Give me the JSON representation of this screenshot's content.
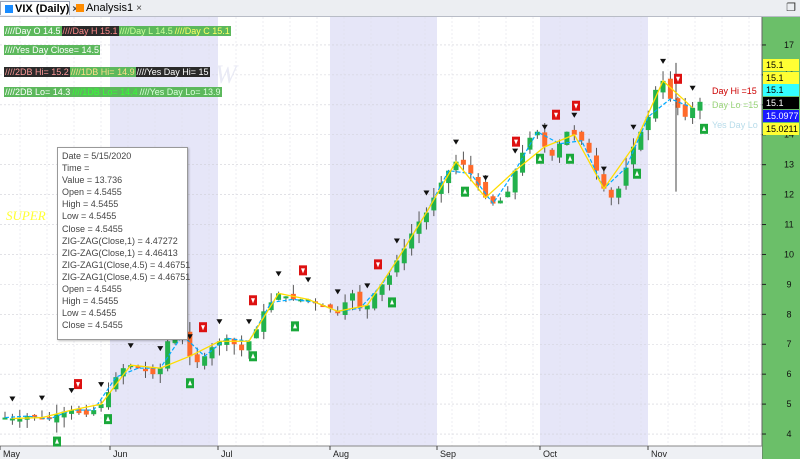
{
  "tabs": [
    {
      "label": "VIX (Daily)",
      "active": true
    },
    {
      "label": "Analysis1",
      "active": false
    }
  ],
  "header": {
    "row1": [
      "////Day O 14.5",
      "////Day H 15.1",
      "////Day L 14.5",
      "////Day C 15.1"
    ],
    "row2": "////Yes Day Close= 14.5",
    "row3": [
      "////2DB Hi= 15.2",
      "////1DB Hi= 14.9",
      "////Yes Day Hi= 15"
    ],
    "row4": [
      "////2DB Lo= 14.3",
      "////1DB Lo= 14.4",
      "////Yes Day Lo= 13.9"
    ]
  },
  "super_label": "SUPER",
  "infobox": {
    "lines": [
      "Date = 5/15/2020",
      "Time =",
      "Value = 13.736",
      "Open = 4.5455",
      "High = 4.5455",
      "Low = 4.5455",
      "Close = 4.5455",
      "ZIG-ZAG(Close,1) = 4.47272",
      "ZIG-ZAG(Close,1) = 4.46413",
      "ZIG-ZAG1(Close,4.5) = 4.46751",
      "ZIG-ZAG1(Close,4.5) = 4.46751",
      "Open = 4.5455",
      "High = 4.5455",
      "Low = 4.5455",
      "Close = 4.5455"
    ]
  },
  "right_labels": [
    {
      "text": "Day Hi =15",
      "color": "#cc0000"
    },
    {
      "text": "Day Lo =15",
      "color": "#9ad47a"
    },
    {
      "text": "Yes Day Lo",
      "color": "#b8dcea"
    }
  ],
  "price_tags": [
    {
      "text": "15.1",
      "bg": "#ffff33",
      "fg": "#000"
    },
    {
      "text": "15.1",
      "bg": "#ffff33",
      "fg": "#000"
    },
    {
      "text": "15.1",
      "bg": "#33ffff",
      "fg": "#000"
    },
    {
      "text": "15.1",
      "bg": "#000",
      "fg": "#fff"
    },
    {
      "text": "15.0977",
      "bg": "#1a1aff",
      "fg": "#fff"
    },
    {
      "text": "15.0211",
      "bg": "#ffff33",
      "fg": "#000"
    }
  ],
  "colors": {
    "up": "#22b14c",
    "down": "#ff6a2a",
    "zigzag": "#00aaff",
    "yellow": "#ffdd00",
    "shade": "#e6e6f8",
    "axis_bg": "#6bbf69"
  },
  "chart_data": {
    "type": "candlestick",
    "x_labels": [
      "May",
      "Jun",
      "Jul",
      "Aug",
      "Sep",
      "Oct",
      "Nov"
    ],
    "y_ticks": [
      4,
      5,
      6,
      7,
      8,
      9,
      10,
      11,
      12,
      13,
      14,
      15,
      16,
      17
    ],
    "ylim": [
      3.6,
      17.6
    ],
    "grid": true,
    "close_path": [
      4.55,
      4.52,
      4.5,
      4.6,
      4.62,
      4.55,
      4.5,
      4.65,
      4.75,
      4.8,
      4.7,
      4.65,
      4.8,
      5,
      5.4,
      5.9,
      6.2,
      6.3,
      6.2,
      6.1,
      6,
      6.2,
      7.1,
      7.6,
      7.3,
      6.6,
      6.4,
      6.6,
      6.9,
      7.1,
      7.2,
      7,
      6.8,
      7.1,
      7.5,
      8.1,
      8.4,
      8.7,
      8.6,
      8.5,
      8.5,
      8.5,
      8.4,
      8.3,
      8.2,
      8.1,
      8.4,
      8.7,
      8.2,
      8.3,
      8.7,
      9,
      9.3,
      9.8,
      10.2,
      10.7,
      11.1,
      11.4,
      11.9,
      12.4,
      12.8,
      13.1,
      13,
      12.7,
      12.3,
      11.9,
      11.7,
      11.8,
      12.1,
      12.8,
      13.4,
      13.9,
      14.1,
      13.6,
      13.3,
      13.7,
      14.1,
      14,
      13.8,
      13.4,
      12.8,
      12.2,
      11.9,
      12.2,
      12.9,
      13.6,
      14.1,
      14.6,
      15.5,
      15.8,
      15.2,
      14.9,
      14.6,
      14.9,
      15.1
    ],
    "up_arrow_x": [
      57,
      108,
      190,
      253,
      295,
      392,
      465,
      540,
      570,
      637,
      704
    ],
    "down_arrow_x": [
      78,
      203,
      253,
      303,
      378,
      516,
      556,
      576,
      678
    ]
  }
}
